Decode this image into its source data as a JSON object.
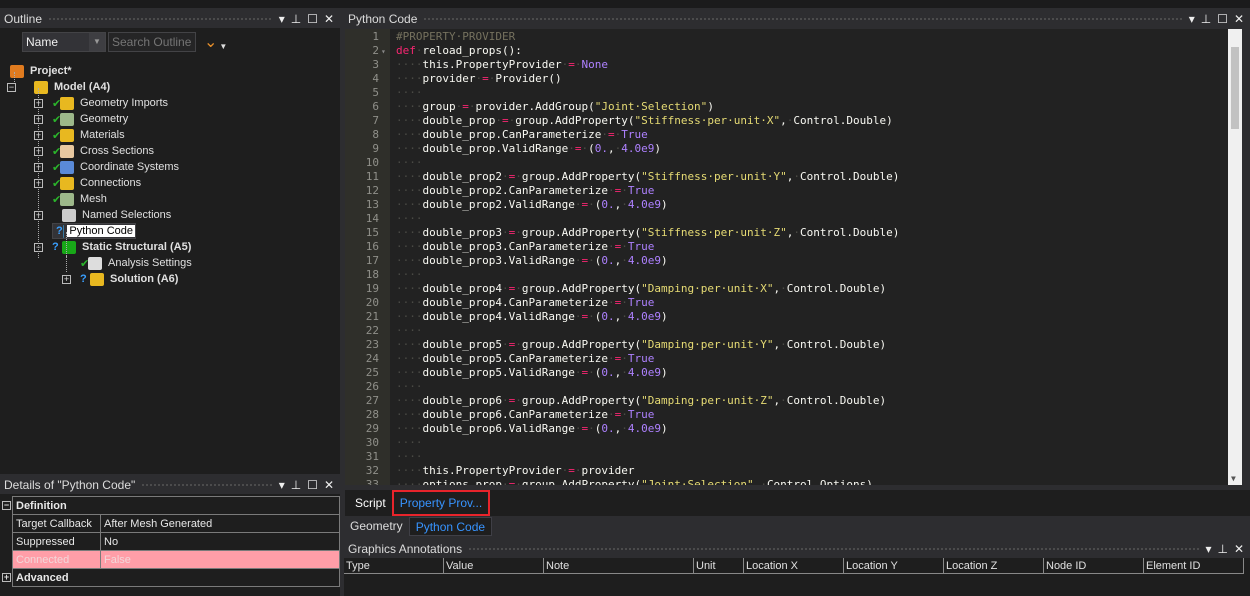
{
  "outline": {
    "title": "Outline",
    "filter_select": "Name",
    "search_placeholder": "Search Outline",
    "tree": [
      {
        "label": "Project*",
        "bold": true,
        "icon": "project-icon",
        "status": "none",
        "color": "#e07b1f"
      },
      {
        "label": "Model (A4)",
        "bold": true,
        "icon": "model-folder-icon",
        "status": "none",
        "color": "#e8b820"
      },
      {
        "label": "Geometry Imports",
        "icon": "geometry-imports-icon",
        "status": "check",
        "color": "#e8b820"
      },
      {
        "label": "Geometry",
        "icon": "geometry-icon",
        "status": "check",
        "color": "#9db88a"
      },
      {
        "label": "Materials",
        "icon": "materials-icon",
        "status": "check",
        "color": "#e8b820"
      },
      {
        "label": "Cross Sections",
        "icon": "cross-sections-icon",
        "status": "check",
        "color": "#e8c8a0"
      },
      {
        "label": "Coordinate Systems",
        "icon": "coordinate-systems-icon",
        "status": "check",
        "color": "#5a8ad8"
      },
      {
        "label": "Connections",
        "icon": "connections-icon",
        "status": "check",
        "color": "#e8b820"
      },
      {
        "label": "Mesh",
        "icon": "mesh-icon",
        "status": "check",
        "color": "#9db88a"
      },
      {
        "label": "Named Selections",
        "icon": "named-selections-icon",
        "status": "none",
        "color": "#cccccc"
      },
      {
        "label": "Python Code",
        "icon": "python-code-icon",
        "status": "question",
        "color": "#3a7aa0",
        "selected": true
      },
      {
        "label": "Static Structural (A5)",
        "bold": true,
        "icon": "static-structural-icon",
        "status": "question",
        "color": "#18a818"
      },
      {
        "label": "Analysis Settings",
        "icon": "analysis-settings-icon",
        "status": "check",
        "color": "#dddddd"
      },
      {
        "label": "Solution (A6)",
        "bold": true,
        "icon": "solution-icon",
        "status": "question",
        "color": "#e8b820"
      }
    ]
  },
  "details": {
    "title": "Details of \"Python Code\"",
    "groups": [
      {
        "label": "Definition",
        "expanded": true,
        "rows": [
          {
            "name": "Target Callback",
            "value": "After Mesh Generated"
          },
          {
            "name": "Suppressed",
            "value": "No"
          },
          {
            "name": "Connected",
            "value": "False",
            "highlight": "#ff9ea8"
          }
        ]
      },
      {
        "label": "Advanced",
        "expanded": false,
        "rows": []
      }
    ]
  },
  "editor": {
    "title": "Python Code",
    "lines": [
      "#PROPERTY PROVIDER",
      "def reload_props():",
      "    this.PropertyProvider = None",
      "    provider = Provider()",
      "    ",
      "    group = provider.AddGroup(\"Joint Selection\")",
      "    double_prop = group.AddProperty(\"Stiffness per unit X\", Control.Double)",
      "    double_prop.CanParameterize = True",
      "    double_prop.ValidRange = (0., 4.0e9)",
      "    ",
      "    double_prop2 = group.AddProperty(\"Stiffness per unit Y\", Control.Double)",
      "    double_prop2.CanParameterize = True",
      "    double_prop2.ValidRange = (0., 4.0e9)",
      "    ",
      "    double_prop3 = group.AddProperty(\"Stiffness per unit Z\", Control.Double)",
      "    double_prop3.CanParameterize = True",
      "    double_prop3.ValidRange = (0., 4.0e9)",
      "    ",
      "    double_prop4 = group.AddProperty(\"Damping per unit X\", Control.Double)",
      "    double_prop4.CanParameterize = True",
      "    double_prop4.ValidRange = (0., 4.0e9)",
      "    ",
      "    double_prop5 = group.AddProperty(\"Damping per unit Y\", Control.Double)",
      "    double_prop5.CanParameterize = True",
      "    double_prop5.ValidRange = (0., 4.0e9)",
      "    ",
      "    double_prop6 = group.AddProperty(\"Damping per unit Z\", Control.Double)",
      "    double_prop6.CanParameterize = True",
      "    double_prop6.ValidRange = (0., 4.0e9)",
      "    ",
      "    ",
      "    this.PropertyProvider = provider",
      "    options_prop = group.AddProperty(\"Joint Selection\", Control.Options)"
    ],
    "colors": {
      "comment": "#75715e",
      "keyword": "#f92672",
      "string": "#e6db74",
      "number": "#ae81ff",
      "text": "#f8f8f2"
    }
  },
  "editor_tabs": [
    {
      "label": "Script",
      "active": false
    },
    {
      "label": "Property Prov...",
      "active": true,
      "highlighted": true
    }
  ],
  "bottom_tabs": [
    {
      "label": "Geometry",
      "active": false
    },
    {
      "label": "Python Code",
      "active": true
    }
  ],
  "annotations": {
    "title": "Graphics Annotations",
    "columns": [
      "Type",
      "Value",
      "Note",
      "Unit",
      "Location X",
      "Location Y",
      "Location Z",
      "Node ID",
      "Element ID"
    ]
  },
  "colors": {
    "accent": "#3794ff",
    "highlight_box": "#e8242b"
  }
}
